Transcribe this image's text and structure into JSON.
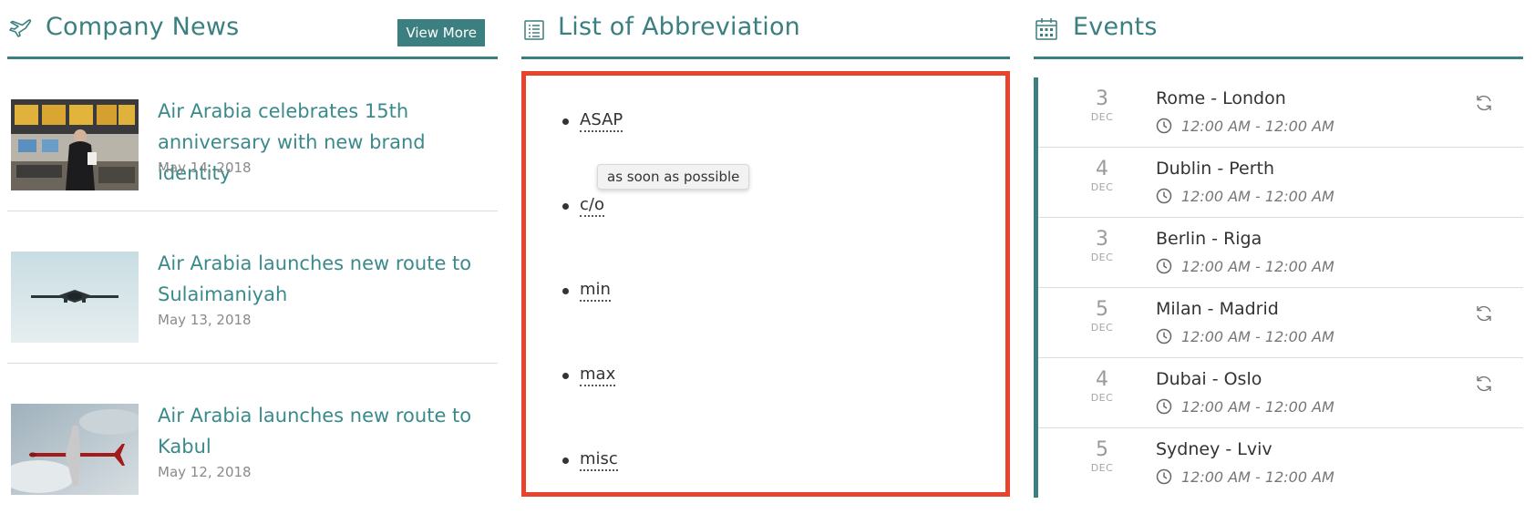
{
  "news": {
    "title": "Company News",
    "icon": "airplane-icon",
    "view_more_label": "View More",
    "items": [
      {
        "title": "Air Arabia celebrates 15th anniversary with new brand identity",
        "date": "May 14, 2018",
        "image": "airport-terminal-photo"
      },
      {
        "title": "Air Arabia launches new route to Sulaimaniyah",
        "date": "May 13, 2018",
        "image": "airplane-in-sky-photo"
      },
      {
        "title": "Air Arabia launches new route to Kabul",
        "date": "May 12, 2018",
        "image": "airplane-above-clouds-photo"
      }
    ]
  },
  "abbreviations": {
    "title": "List of Abbreviation",
    "icon": "list-icon",
    "items": [
      "ASAP",
      "c/o",
      "min",
      "max",
      "misc"
    ],
    "tooltip": "as soon as possible",
    "highlight_color": "#e8432d"
  },
  "events": {
    "title": "Events",
    "icon": "calendar-icon",
    "items": [
      {
        "day": "3",
        "month": "DEC",
        "title": "Rome - London",
        "time": "12:00 AM - 12:00 AM",
        "recurring": true
      },
      {
        "day": "4",
        "month": "DEC",
        "title": "Dublin - Perth",
        "time": "12:00 AM - 12:00 AM",
        "recurring": false
      },
      {
        "day": "3",
        "month": "DEC",
        "title": "Berlin - Riga",
        "time": "12:00 AM - 12:00 AM",
        "recurring": false
      },
      {
        "day": "5",
        "month": "DEC",
        "title": "Milan - Madrid",
        "time": "12:00 AM - 12:00 AM",
        "recurring": true
      },
      {
        "day": "4",
        "month": "DEC",
        "title": "Dubai - Oslo",
        "time": "12:00 AM - 12:00 AM",
        "recurring": true
      },
      {
        "day": "5",
        "month": "DEC",
        "title": "Sydney - Lviv",
        "time": "12:00 AM - 12:00 AM",
        "recurring": false
      }
    ]
  },
  "colors": {
    "accent": "#3b7f80",
    "link": "#3b8a8b"
  }
}
